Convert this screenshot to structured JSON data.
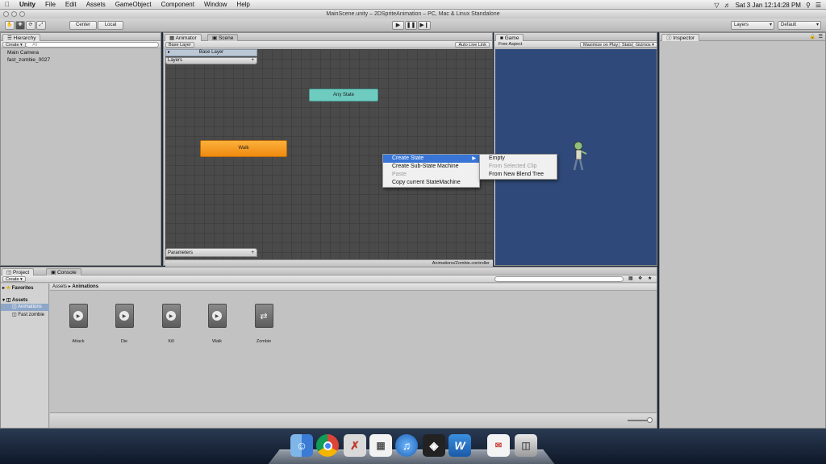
{
  "menubar": {
    "app": "Unity",
    "items": [
      "File",
      "Edit",
      "Assets",
      "GameObject",
      "Component",
      "Window",
      "Help"
    ],
    "clock": "Sat 3 Jan  12:14:28 PM"
  },
  "window": {
    "title": "MainScene.unity – 2DSpriteAnimation – PC, Mac & Linux Standalone"
  },
  "toolbar": {
    "pivot_label": "Center",
    "space_label": "Local",
    "layers_label": "Layers",
    "layout_label": "Default"
  },
  "hierarchy": {
    "tab": "Hierarchy",
    "create_label": "Create",
    "search_placeholder": "All",
    "items": [
      "Main Camera",
      "fast_zombie_0027"
    ]
  },
  "animator": {
    "tabs": [
      "Animator",
      "Scene"
    ],
    "breadcrumb": "Base Layer",
    "auto_live_link": "Auto Live Link",
    "layers_header": "Layers",
    "base_layer_row": "Base Layer",
    "parameters_header": "Parameters",
    "footer_path": "Animations/Zombie.controller",
    "nodes": {
      "any_state": "Any State",
      "walk": "Walk"
    },
    "context_menu": {
      "items": [
        "Create State",
        "Create Sub-State Machine",
        "Paste",
        "Copy current StateMachine"
      ],
      "submenu": [
        "Empty",
        "From Selected Clip",
        "From New Blend Tree"
      ]
    }
  },
  "game": {
    "tab": "Game",
    "aspect": "Free Aspect",
    "maximize": "Maximize on Play",
    "stats": "Stats",
    "gizmos": "Gizmos"
  },
  "inspector": {
    "tab": "Inspector"
  },
  "project": {
    "tabs": [
      "Project",
      "Console"
    ],
    "create_label": "Create",
    "favorites": "Favorites",
    "tree": [
      "Assets",
      "Animations",
      "Fast zombie"
    ],
    "breadcrumb": [
      "Assets",
      "Animations"
    ],
    "breadcrumb_sep": "▸",
    "assets": [
      "Attack",
      "Die",
      "Kill",
      "Walk",
      "Zombie"
    ]
  },
  "colors": {
    "any_state": "#6ecbc0",
    "walk_state": "#f49c1c",
    "game_bg": "#2f4a7a",
    "selection": "#3875d7"
  }
}
